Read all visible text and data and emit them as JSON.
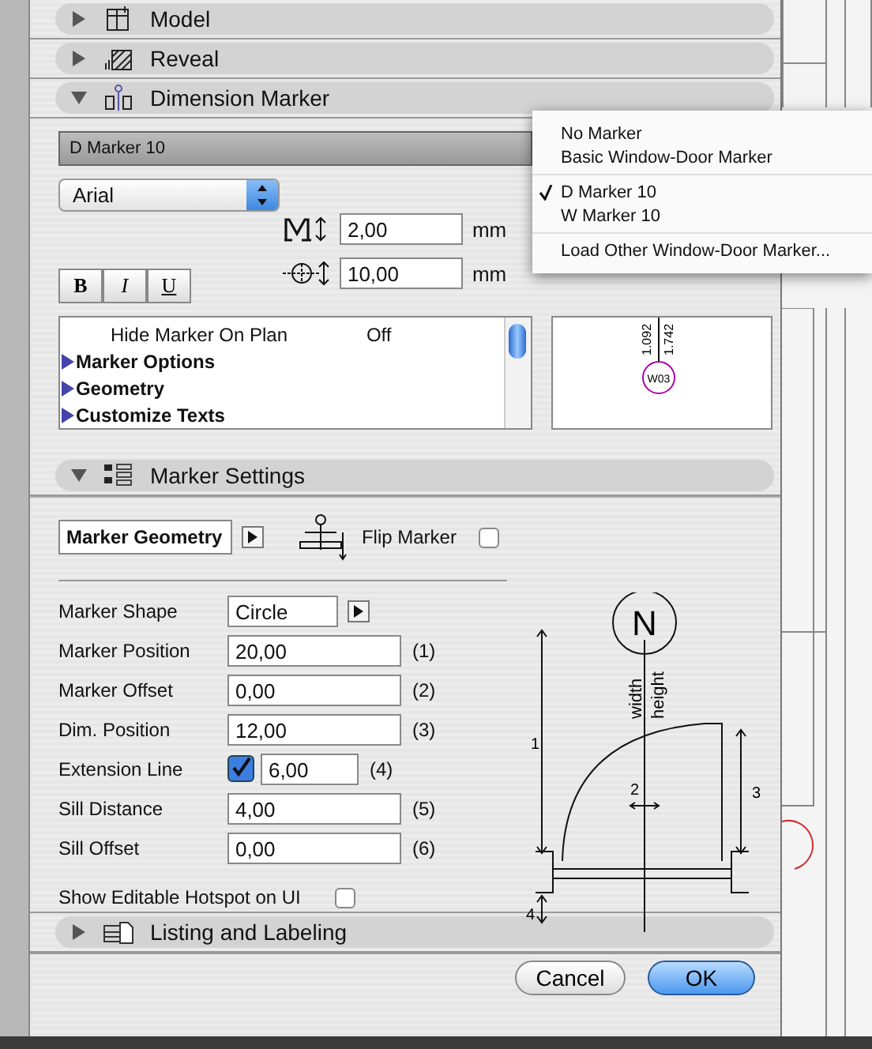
{
  "top_headers": [
    {
      "title": "Model",
      "expanded": false,
      "kind": "model"
    },
    {
      "title": "Reveal",
      "expanded": false,
      "kind": "reveal"
    },
    {
      "title": "Dimension Marker",
      "expanded": true,
      "kind": "marker"
    }
  ],
  "dimension_marker": {
    "marker_popup": "D Marker 10",
    "font_popup": "Arial",
    "sizes": [
      {
        "kind": "text",
        "value": "2,00",
        "unit": "mm"
      },
      {
        "kind": "marker",
        "value": "10,00",
        "unit": "mm"
      }
    ],
    "style_buttons": [
      "B",
      "I",
      "U"
    ],
    "params": [
      {
        "kind": "param",
        "label": "Hide Marker On Plan",
        "value": "Off"
      },
      {
        "kind": "group",
        "label": "Marker Options",
        "expanded": false
      },
      {
        "kind": "group",
        "label": "Geometry",
        "expanded": false
      },
      {
        "kind": "group",
        "label": "Customize Texts",
        "expanded": false
      }
    ],
    "preview": {
      "dims": [
        "1.092",
        "1.742"
      ],
      "tag": "W03"
    }
  },
  "marker_menu": [
    [
      {
        "label": "No Marker",
        "selected": false
      },
      {
        "label": "Basic Window-Door Marker",
        "selected": false
      }
    ],
    [
      {
        "label": "D Marker 10",
        "selected": true
      },
      {
        "label": "W Marker 10",
        "selected": false
      }
    ],
    [
      {
        "label": "Load Other Window-Door Marker...",
        "selected": false
      }
    ]
  ],
  "marker_settings": {
    "header": {
      "title": "Marker Settings",
      "expanded": true,
      "kind": "settings"
    },
    "page_popup": "Marker Geometry",
    "flip": {
      "label": "Flip Marker",
      "checked": false
    },
    "fields": [
      {
        "kind": "popup",
        "label": "Marker Shape",
        "value": "Circle"
      },
      {
        "kind": "field",
        "label": "Marker Position",
        "value": "20,00",
        "index": "(1)"
      },
      {
        "kind": "field",
        "label": "Marker Offset",
        "value": "0,00",
        "index": "(2)"
      },
      {
        "kind": "field",
        "label": "Dim. Position",
        "value": "12,00",
        "index": "(3)"
      },
      {
        "kind": "checkfield",
        "label": "Extension Line",
        "value": "6,00",
        "index": "(4)",
        "checked": true
      },
      {
        "kind": "field",
        "label": "Sill Distance",
        "value": "4,00",
        "index": "(5)"
      },
      {
        "kind": "field",
        "label": "Sill Offset",
        "value": "0,00",
        "index": "(6)"
      }
    ],
    "hotspot": {
      "label": "Show Editable Hotspot on UI",
      "checked": false
    },
    "diagram": {
      "north": "N",
      "width": "width",
      "height": "height",
      "dims": [
        "1",
        "2",
        "3",
        "4"
      ]
    }
  },
  "bottom_header": {
    "title": "Listing and Labeling",
    "expanded": false,
    "kind": "listing"
  },
  "buttons": [
    {
      "label": "Cancel",
      "default": false
    },
    {
      "label": "OK",
      "default": true
    }
  ]
}
